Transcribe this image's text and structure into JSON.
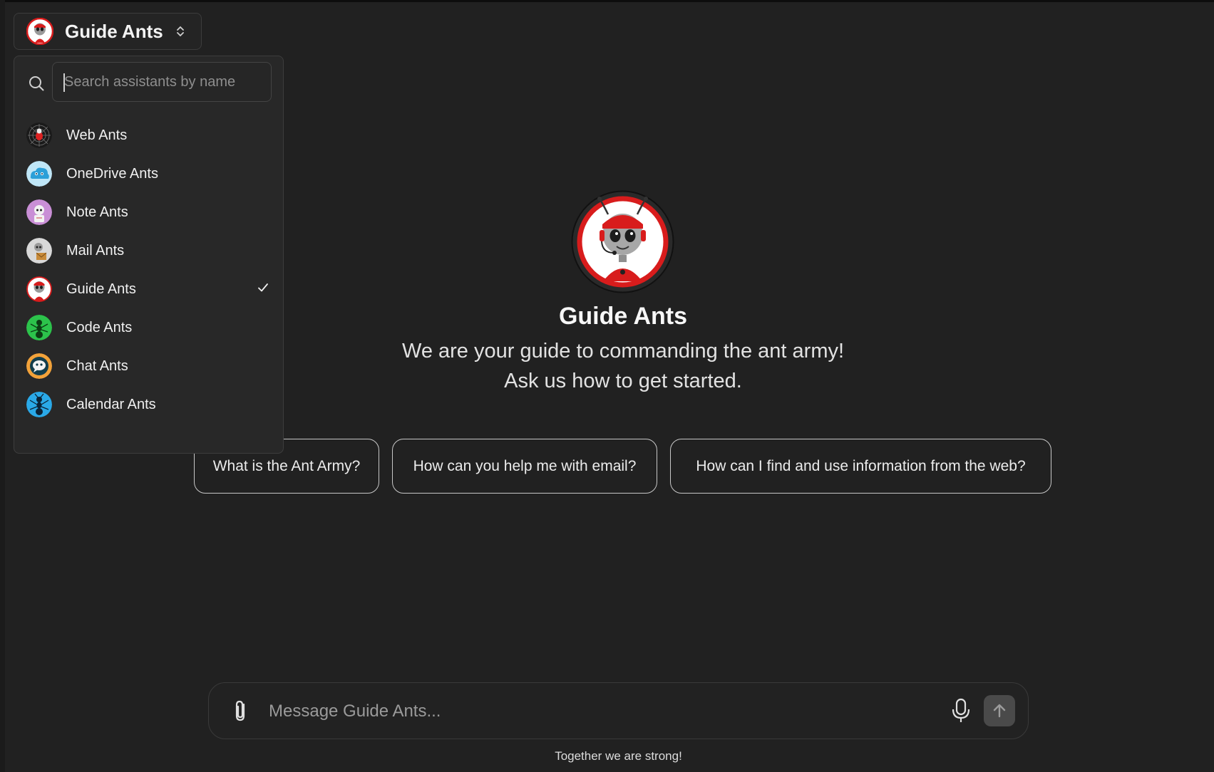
{
  "selector": {
    "title": "Guide Ants",
    "avatar_icon": "guide-ant-avatar",
    "chevron_icon": "chevron-up-down-icon"
  },
  "dropdown": {
    "search_placeholder": "Search assistants by name",
    "items": [
      {
        "label": "Web Ants",
        "icon": "web-ant-avatar",
        "colors": [
          "#1a1a1a",
          "#d22"
        ]
      },
      {
        "label": "OneDrive Ants",
        "icon": "onedrive-ant-avatar",
        "colors": [
          "#bfe6f7",
          "#2b9fd8"
        ]
      },
      {
        "label": "Note Ants",
        "icon": "note-ant-avatar",
        "colors": [
          "#c98fd6",
          "#f2f2f2"
        ]
      },
      {
        "label": "Mail Ants",
        "icon": "mail-ant-avatar",
        "colors": [
          "#d8d8d8",
          "#c88b3a"
        ]
      },
      {
        "label": "Guide Ants",
        "icon": "guide-ant-avatar",
        "colors": [
          "#ffffff",
          "#d81c1c"
        ],
        "selected": true
      },
      {
        "label": "Code Ants",
        "icon": "code-ant-avatar",
        "colors": [
          "#2cc34b",
          "#0c3d14"
        ]
      },
      {
        "label": "Chat Ants",
        "icon": "chat-ant-avatar",
        "colors": [
          "#f2a23a",
          "#123d4c"
        ]
      },
      {
        "label": "Calendar Ants",
        "icon": "calendar-ant-avatar",
        "colors": [
          "#2aa9e8",
          "#0b2236"
        ]
      }
    ]
  },
  "hero": {
    "title": "Guide Ants",
    "description_line1": "We are your guide to commanding the ant army!",
    "description_line2": "Ask us how to get started."
  },
  "suggestions": [
    "What is the Ant Army?",
    "How can you help me with email?",
    "How can I find and use information from the web?"
  ],
  "composer": {
    "placeholder": "Message Guide Ants...",
    "attach_icon": "paperclip-icon",
    "mic_icon": "microphone-icon",
    "send_icon": "arrow-up-icon"
  },
  "footer": "Together we are strong!",
  "colors": {
    "background": "#212121",
    "accent_red": "#d81c1c"
  }
}
